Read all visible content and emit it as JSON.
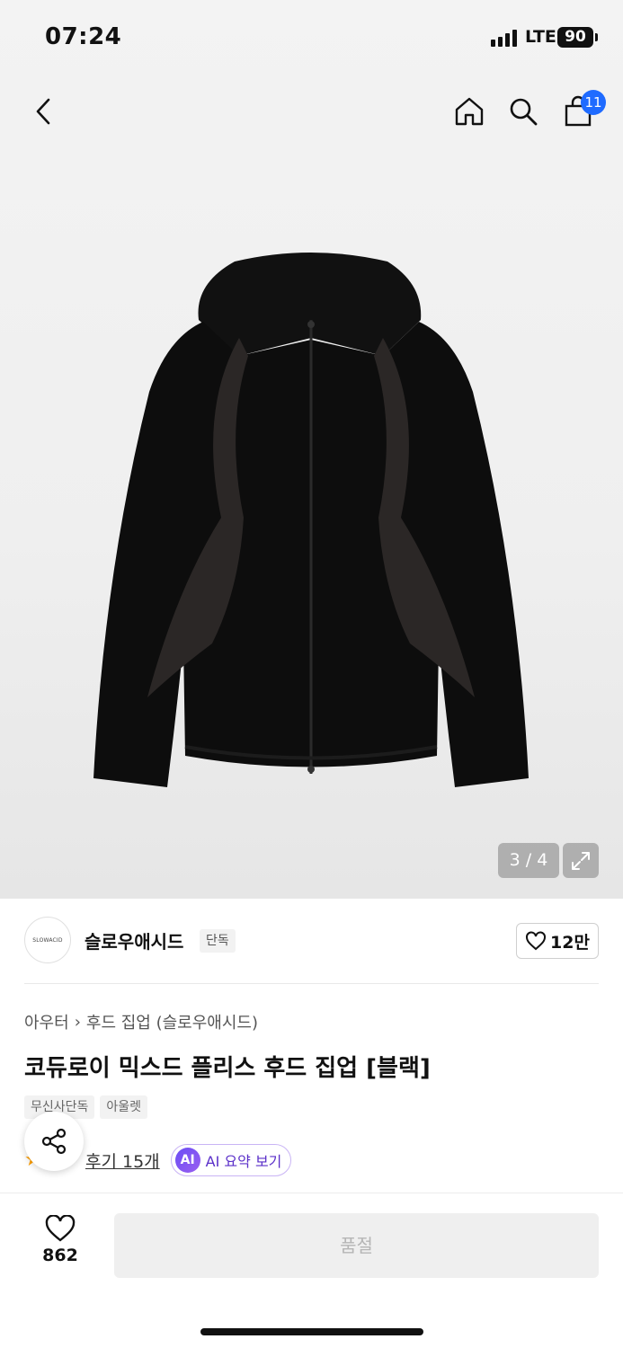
{
  "status_bar": {
    "time": "07:24",
    "network": "LTE",
    "battery": "90"
  },
  "header": {
    "cart_count": "11"
  },
  "gallery": {
    "counter": "3 / 4"
  },
  "brand": {
    "logo_text": "SLOWACID",
    "name": "슬로우애시드",
    "tag": "단독",
    "likes": "12만"
  },
  "product": {
    "breadcrumb": [
      "아우터",
      "후드 집업 (슬로우애시드)"
    ],
    "title": "코듀로이 믹스드 플리스 후드 집업 [블랙]",
    "tags": [
      "무신사단독",
      "아울렛"
    ],
    "review_link": "후기 15개",
    "ai_badge": "AI",
    "ai_label": "AI 요약 보기"
  },
  "bottom_bar": {
    "like_count": "862",
    "buy_button": "품절"
  },
  "colors": {
    "accent_blue": "#1f6bff",
    "ai_purple": "#5a2fc9",
    "star": "#ff9f00"
  }
}
